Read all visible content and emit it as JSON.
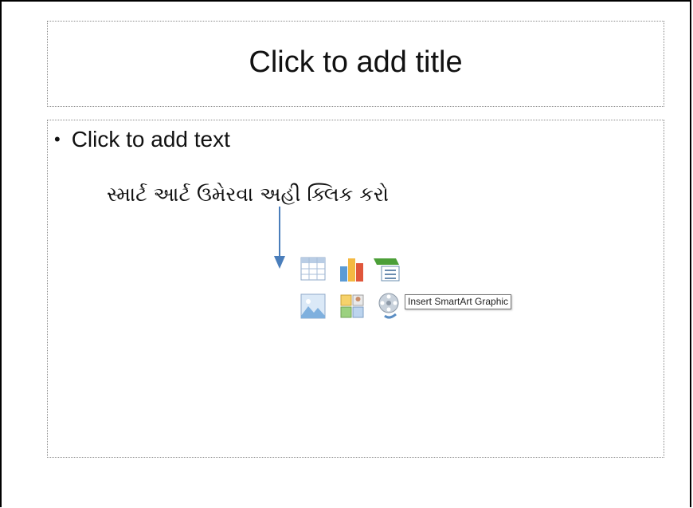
{
  "slide": {
    "title_placeholder": "Click to add title",
    "body_placeholder": "Click to add text",
    "bullet": "•",
    "annotation_text": "સ્માર્ટ આર્ટ ઉમેરવા અહી ક્લિક કરો"
  },
  "content_icons": [
    {
      "name": "insert-table-icon"
    },
    {
      "name": "insert-chart-icon"
    },
    {
      "name": "insert-smartart-icon"
    },
    {
      "name": "insert-picture-icon"
    },
    {
      "name": "insert-clip-art-icon"
    },
    {
      "name": "insert-media-clip-icon"
    }
  ],
  "tooltip": {
    "text": "Insert SmartArt Graphic"
  },
  "colors": {
    "arrow": "#4a7ebb",
    "placeholder_border": "#8a8a8a"
  }
}
